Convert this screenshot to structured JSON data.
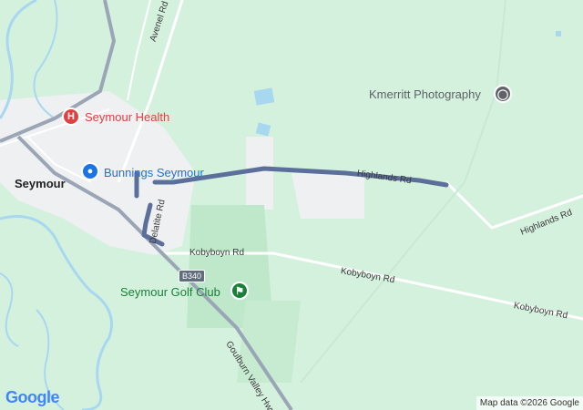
{
  "map": {
    "town_label": "Seymour",
    "pois": {
      "hospital": "Seymour Health",
      "store": "Bunnings Seymour",
      "golf": "Seymour Golf Club",
      "photo": "Kmerritt Photography"
    },
    "roads": {
      "avenel": "Avenel Rd",
      "delatite": "Delatite Rd",
      "highlands_1": "Highlands Rd",
      "highlands_2": "Highlands Rd",
      "kobyboyn_1": "Kobyboyn Rd",
      "kobyboyn_2": "Kobyboyn Rd",
      "kobyboyn_3": "Kobyboyn Rd",
      "goulburn": "Goulburn Valley Hwy",
      "shield": "B340"
    },
    "logo": "Google",
    "attribution": "Map data ©2026 Google"
  },
  "colors": {
    "land": "#d4f1de",
    "urban": "#eceff1",
    "water": "#a8d8f0",
    "route": "#5b6f9a",
    "hospital": "#e0403f",
    "store": "#1a73e8",
    "golf": "#188038"
  }
}
